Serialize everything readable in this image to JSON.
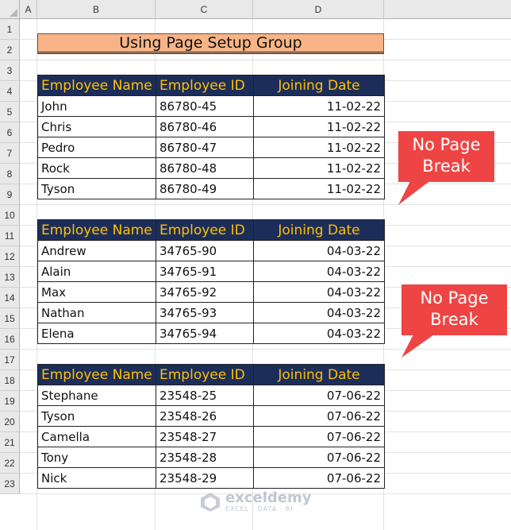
{
  "columns": [
    "A",
    "B",
    "C",
    "D"
  ],
  "rows": [
    "1",
    "2",
    "3",
    "4",
    "5",
    "6",
    "7",
    "8",
    "9",
    "10",
    "11",
    "12",
    "13",
    "14",
    "15",
    "16",
    "17",
    "18",
    "19",
    "20",
    "21",
    "22",
    "23"
  ],
  "title": "Using Page Setup Group",
  "headers": {
    "name": "Employee Name",
    "id": "Employee ID",
    "date": "Joining Date"
  },
  "tables": [
    {
      "rows": [
        {
          "name": "John",
          "id": "86780-45",
          "date": "11-02-22"
        },
        {
          "name": "Chris",
          "id": "86780-46",
          "date": "11-02-22"
        },
        {
          "name": "Pedro",
          "id": "86780-47",
          "date": "11-02-22"
        },
        {
          "name": "Rock",
          "id": "86780-48",
          "date": "11-02-22"
        },
        {
          "name": "Tyson",
          "id": "86780-49",
          "date": "11-02-22"
        }
      ]
    },
    {
      "rows": [
        {
          "name": "Andrew",
          "id": "34765-90",
          "date": "04-03-22"
        },
        {
          "name": "Alain",
          "id": "34765-91",
          "date": "04-03-22"
        },
        {
          "name": "Max",
          "id": "34765-92",
          "date": "04-03-22"
        },
        {
          "name": "Nathan",
          "id": "34765-93",
          "date": "04-03-22"
        },
        {
          "name": "Elena",
          "id": "34765-94",
          "date": "04-03-22"
        }
      ]
    },
    {
      "rows": [
        {
          "name": "Stephane",
          "id": "23548-25",
          "date": "07-06-22"
        },
        {
          "name": "Tyson",
          "id": "23548-26",
          "date": "07-06-22"
        },
        {
          "name": "Camella",
          "id": "23548-27",
          "date": "07-06-22"
        },
        {
          "name": "Tony",
          "id": "23548-28",
          "date": "07-06-22"
        },
        {
          "name": "Nick",
          "id": "23548-29",
          "date": "07-06-22"
        }
      ]
    }
  ],
  "callouts": [
    {
      "line1": "No Page",
      "line2": "Break"
    },
    {
      "line1": "No Page",
      "line2": "Break"
    }
  ],
  "watermark": {
    "name": "exceldemy",
    "tagline": "EXCEL · DATA · BI"
  },
  "colors": {
    "header_bg": "#1c2d5a",
    "header_text": "#ffc000",
    "title_bg": "#f8b486",
    "callout_bg": "#ef4444"
  }
}
